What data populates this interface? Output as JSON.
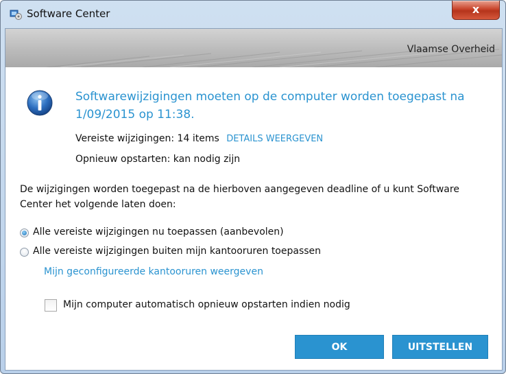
{
  "window": {
    "title": "Software Center",
    "close_symbol": "x",
    "app_icon": "software-center-icon"
  },
  "banner": {
    "organization": "Vlaamse Overheid"
  },
  "message": {
    "icon": "info-icon",
    "headline": "Softwarewijzigingen moeten op de computer worden toegepast na 1/09/2015 op 11:38.",
    "required_label": "Vereiste wijzigingen: 14 items",
    "details_link": "DETAILS WEERGEVEN",
    "restart_label": "Opnieuw opstarten: kan nodig zijn"
  },
  "paragraph": "De wijzigingen worden toegepast na de hierboven aangegeven deadline of u kunt Software Center het volgende laten doen:",
  "options": [
    {
      "label": "Alle vereiste wijzigingen nu toepassen (aanbevolen)",
      "selected": true
    },
    {
      "label": "Alle vereiste wijzigingen buiten mijn kantooruren toepassen",
      "selected": false
    }
  ],
  "business_hours_link": "Mijn geconfigureerde kantooruren weergeven",
  "auto_restart": {
    "label": "Mijn computer automatisch opnieuw opstarten indien nodig",
    "checked": false
  },
  "buttons": {
    "ok": "OK",
    "postpone": "UITSTELLEN"
  },
  "colors": {
    "accent": "#2a93d0",
    "close": "#c9452c"
  }
}
